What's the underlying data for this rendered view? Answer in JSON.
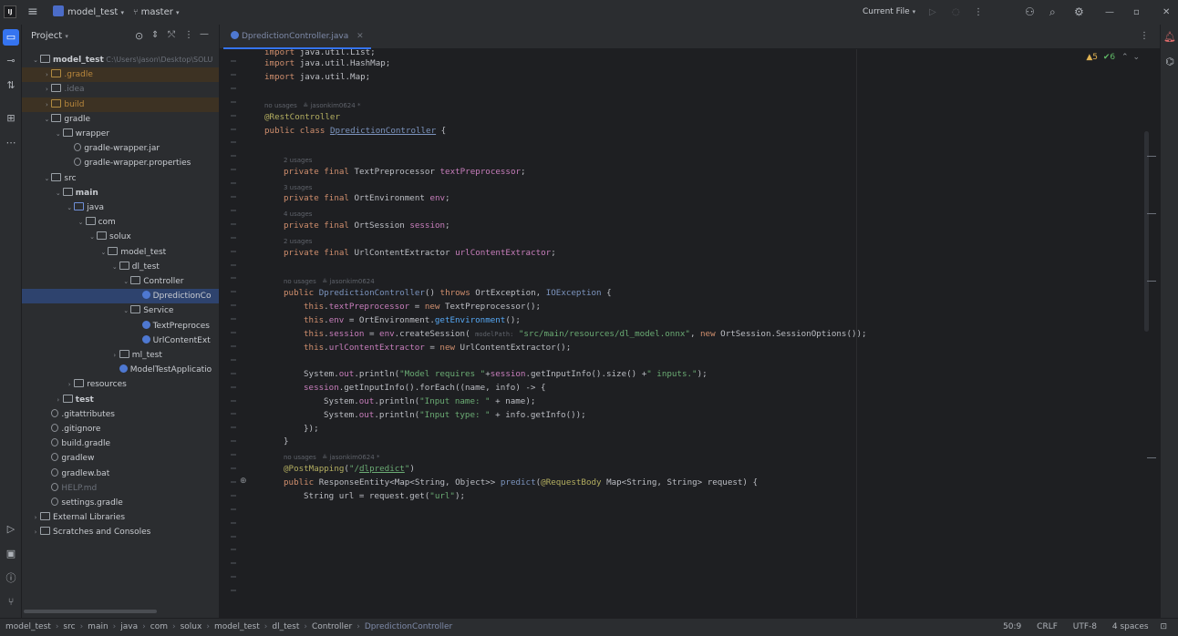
{
  "titlebar": {
    "project_name": "model_test",
    "branch": "master",
    "run_config": "Current File",
    "logo_text": "IJ"
  },
  "project_panel": {
    "title": "Project",
    "tree": [
      {
        "label": "model_test",
        "path": "C:\\Users\\jason\\Desktop\\SOLU",
        "depth": 0,
        "expanded": true,
        "icon": "folder",
        "bold": true
      },
      {
        "label": ".gradle",
        "depth": 1,
        "expanded": false,
        "icon": "excluded",
        "style": "excluded"
      },
      {
        "label": ".idea",
        "depth": 1,
        "expanded": false,
        "icon": "folder",
        "style": "dim"
      },
      {
        "label": "build",
        "depth": 1,
        "expanded": false,
        "icon": "excluded",
        "style": "excluded"
      },
      {
        "label": "gradle",
        "depth": 1,
        "expanded": true,
        "icon": "folder"
      },
      {
        "label": "wrapper",
        "depth": 2,
        "expanded": true,
        "icon": "folder"
      },
      {
        "label": "gradle-wrapper.jar",
        "depth": 3,
        "icon": "file"
      },
      {
        "label": "gradle-wrapper.properties",
        "depth": 3,
        "icon": "file"
      },
      {
        "label": "src",
        "depth": 1,
        "expanded": true,
        "icon": "folder"
      },
      {
        "label": "main",
        "depth": 2,
        "expanded": true,
        "icon": "folder",
        "bold": true
      },
      {
        "label": "java",
        "depth": 3,
        "expanded": true,
        "icon": "src"
      },
      {
        "label": "com",
        "depth": 4,
        "expanded": true,
        "icon": "folder"
      },
      {
        "label": "solux",
        "depth": 5,
        "expanded": true,
        "icon": "folder"
      },
      {
        "label": "model_test",
        "depth": 6,
        "expanded": true,
        "icon": "folder"
      },
      {
        "label": "dl_test",
        "depth": 7,
        "expanded": true,
        "icon": "folder"
      },
      {
        "label": "Controller",
        "depth": 8,
        "expanded": true,
        "icon": "folder"
      },
      {
        "label": "DpredictionCo",
        "depth": 9,
        "icon": "java",
        "selected": true
      },
      {
        "label": "Service",
        "depth": 8,
        "expanded": true,
        "icon": "folder"
      },
      {
        "label": "TextPreproces",
        "depth": 9,
        "icon": "java"
      },
      {
        "label": "UrlContentExt",
        "depth": 9,
        "icon": "java"
      },
      {
        "label": "ml_test",
        "depth": 7,
        "expanded": false,
        "icon": "folder"
      },
      {
        "label": "ModelTestApplicatio",
        "depth": 7,
        "icon": "java"
      },
      {
        "label": "resources",
        "depth": 3,
        "expanded": false,
        "icon": "folder"
      },
      {
        "label": "test",
        "depth": 2,
        "expanded": false,
        "icon": "folder",
        "bold": true
      },
      {
        "label": ".gitattributes",
        "depth": 1,
        "icon": "file"
      },
      {
        "label": ".gitignore",
        "depth": 1,
        "icon": "file"
      },
      {
        "label": "build.gradle",
        "depth": 1,
        "icon": "file"
      },
      {
        "label": "gradlew",
        "depth": 1,
        "icon": "file"
      },
      {
        "label": "gradlew.bat",
        "depth": 1,
        "icon": "file"
      },
      {
        "label": "HELP.md",
        "depth": 1,
        "icon": "file",
        "style": "dim"
      },
      {
        "label": "settings.gradle",
        "depth": 1,
        "icon": "file"
      },
      {
        "label": "External Libraries",
        "depth": 0,
        "expanded": false,
        "icon": "folder"
      },
      {
        "label": "Scratches and Consoles",
        "depth": 0,
        "expanded": false,
        "icon": "folder"
      }
    ]
  },
  "editor": {
    "tab_label": "DpredictionController.java",
    "inspections": {
      "warnings": "5",
      "checks": "6"
    },
    "lines": [
      {
        "n": "",
        "html": "<span class=\"kw\">import</span> java.util.HashMap;"
      },
      {
        "n": "",
        "html": "<span class=\"kw\">import</span> java.util.Map;"
      }
    ]
  },
  "statusbar": {
    "breadcrumbs": [
      "model_test",
      "src",
      "main",
      "java",
      "com",
      "solux",
      "model_test",
      "dl_test",
      "Controller",
      "DpredictionController"
    ],
    "position": "50:9",
    "line_sep": "CRLF",
    "encoding": "UTF-8",
    "indent": "4 spaces"
  }
}
